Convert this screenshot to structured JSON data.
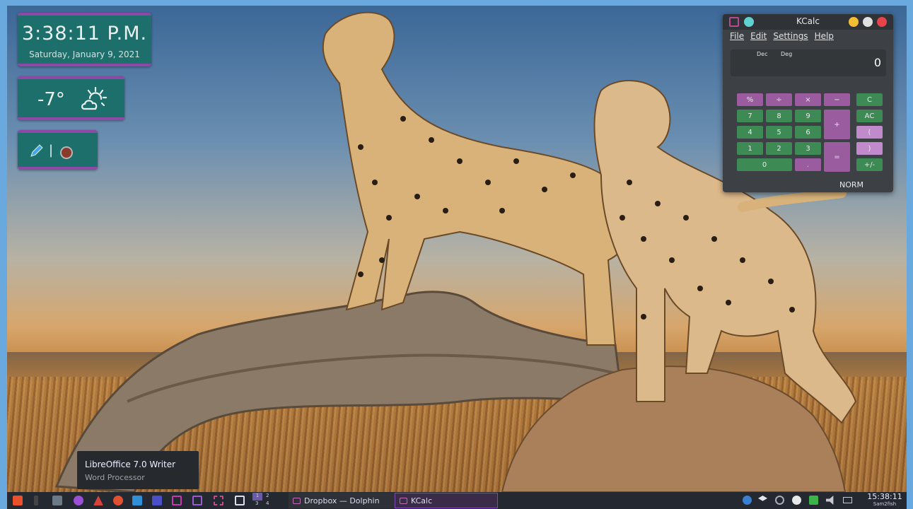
{
  "clock": {
    "time": "3:38:11 P.M.",
    "date": "Saturday, January 9, 2021"
  },
  "weather": {
    "temperature": "-7°",
    "condition_icon": "partly-cloudy-sun-icon"
  },
  "recorder": {
    "separator": "|",
    "pen_icon": "pen-icon",
    "record_icon": "record-icon"
  },
  "kcalc": {
    "title": "KCalc",
    "menu": [
      {
        "label": "File"
      },
      {
        "label": "Edit"
      },
      {
        "label": "Settings"
      },
      {
        "label": "Help"
      }
    ],
    "display": {
      "base": "Dec",
      "angle": "Deg",
      "value": "0"
    },
    "buttons": {
      "percent": "%",
      "divide": "÷",
      "multiply": "×",
      "minus": "−",
      "seven": "7",
      "eight": "8",
      "nine": "9",
      "plus": "+",
      "four": "4",
      "five": "5",
      "six": "6",
      "one": "1",
      "two": "2",
      "three": "3",
      "equals": "=",
      "zero": "0",
      "point": ".",
      "clear": "C",
      "all_clear": "AC",
      "open_paren": "(",
      "close_paren": ")",
      "sign": "+/-"
    },
    "mode": "NORM"
  },
  "tooltip": {
    "title": "LibreOffice 7.0 Writer",
    "subtitle": "Word Processor"
  },
  "taskbar": {
    "tasks": [
      {
        "label": "Dropbox — Dolphin"
      },
      {
        "label": "KCalc"
      }
    ],
    "pager": [
      "1",
      "2",
      "3",
      "4"
    ],
    "clock_time": "15:38:11",
    "clock_user": "Sam2fish"
  },
  "colors": {
    "widget_bg": "#1d6f6b",
    "widget_border": "#8e49a6",
    "kcalc_purple": "#9a5b9f",
    "kcalc_green": "#3d8a55",
    "taskbar": "#242830"
  }
}
